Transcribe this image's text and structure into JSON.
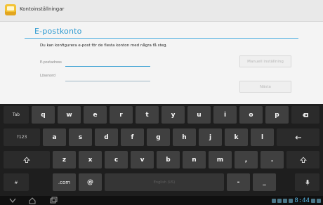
{
  "titlebar": {
    "title": "Kontoinställningar"
  },
  "form": {
    "header": "E-postkonto",
    "description": "Du kan konfigurera e-post för de flesta konton med några få steg.",
    "email_label": "E-postadress",
    "password_label": "Lösenord",
    "manual_button": "Manuell inställning",
    "next_button": "Nästa"
  },
  "keyboard": {
    "row1": [
      "q",
      "w",
      "e",
      "r",
      "t",
      "y",
      "u",
      "i",
      "o",
      "p"
    ],
    "row2": [
      "a",
      "s",
      "d",
      "f",
      "g",
      "h",
      "j",
      "k",
      "l"
    ],
    "row3": [
      "z",
      "x",
      "c",
      "v",
      "b",
      "n",
      "m",
      ",",
      "."
    ],
    "tab_label": "Tab",
    "num_label": "?123",
    "dotcom_label": ".com",
    "at_label": "@",
    "space_label": "English (US)",
    "minus_label": "-",
    "underscore_label": "_",
    "hash_label": "#"
  },
  "status": {
    "time": "8:44"
  }
}
